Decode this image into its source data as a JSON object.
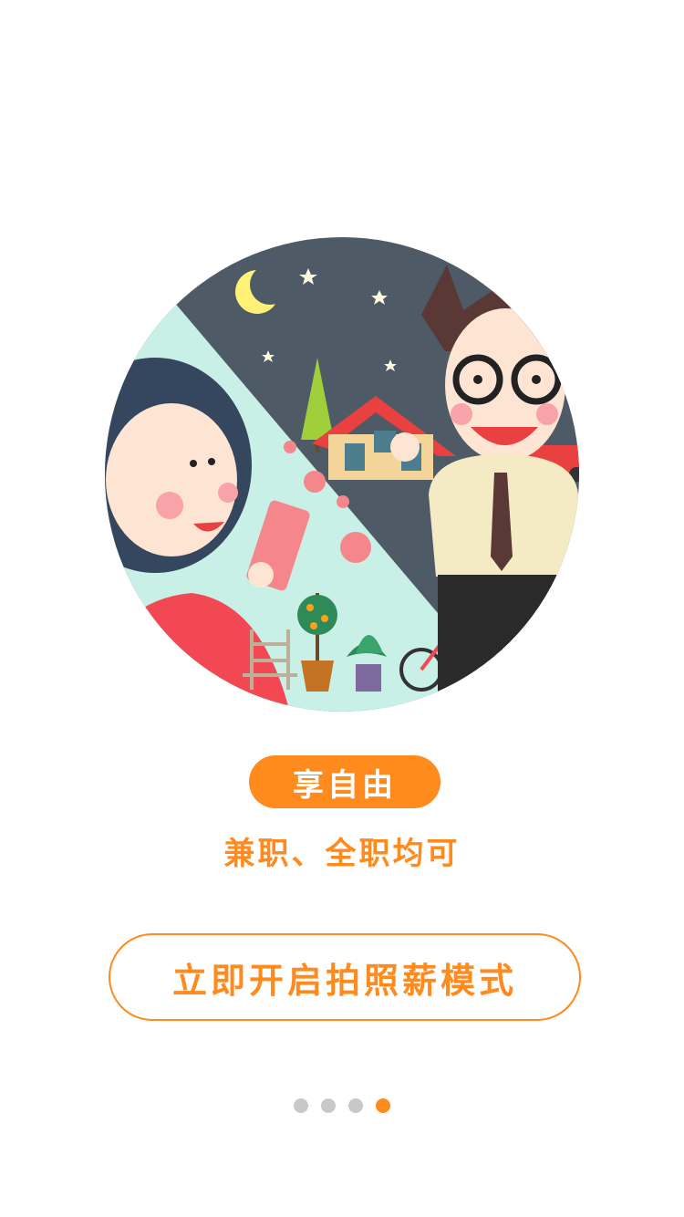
{
  "badge": {
    "label": "享自由"
  },
  "subtitle": "兼职、全职均可",
  "cta": {
    "label": "立即开启拍照薪模式"
  },
  "pager": {
    "total": 4,
    "active_index": 3
  },
  "colors": {
    "accent": "#ff8a1d",
    "dot_inactive": "#c8c8c8",
    "night": "#4e5a66",
    "day": "#c8f0e6"
  },
  "illustration": {
    "icons": [
      "moon-icon",
      "star-icon",
      "house-icon",
      "tree-icon",
      "bicycle-icon",
      "plant-icon",
      "bench-icon",
      "car-icon"
    ]
  }
}
